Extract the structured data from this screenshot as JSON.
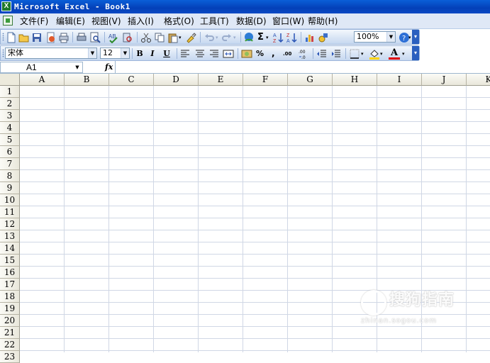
{
  "window": {
    "title": "Microsoft Excel - Book1",
    "app_icon_glyph": "X"
  },
  "menubar": {
    "items": [
      "文件(F)",
      "编辑(E)",
      "视图(V)",
      "插入(I)",
      "格式(O)",
      "工具(T)",
      "数据(D)",
      "窗口(W)",
      "帮助(H)"
    ]
  },
  "toolbar_standard": {
    "zoom": "100%",
    "sum_glyph": "Σ"
  },
  "toolbar_format": {
    "font_name": "宋体",
    "font_size": "12",
    "bold": "B",
    "italic": "I",
    "underline": "U",
    "percent": "%",
    "comma": ",",
    "increase_decimal": ".00",
    "font_color_glyph": "A",
    "highlight_color": "#ffd400",
    "font_color": "#e00000"
  },
  "formula_bar": {
    "name_box": "A1",
    "fx_glyph": "fx",
    "value": ""
  },
  "sheet": {
    "columns": [
      "A",
      "B",
      "C",
      "D",
      "E",
      "F",
      "G",
      "H",
      "I",
      "J",
      "K"
    ],
    "rows": [
      "1",
      "2",
      "3",
      "4",
      "5",
      "6",
      "7",
      "8",
      "9",
      "10",
      "11",
      "12",
      "13",
      "14",
      "15",
      "16",
      "17",
      "18",
      "19",
      "20",
      "21",
      "22",
      "23"
    ]
  },
  "watermark": {
    "brand": "搜狗指南",
    "url": "zhinan.sogou.com"
  },
  "colors": {
    "titlebar": "#0a5fd8",
    "menubar": "#dfe8f6",
    "gridline": "#d0d7e5",
    "header": "#eceadc"
  }
}
